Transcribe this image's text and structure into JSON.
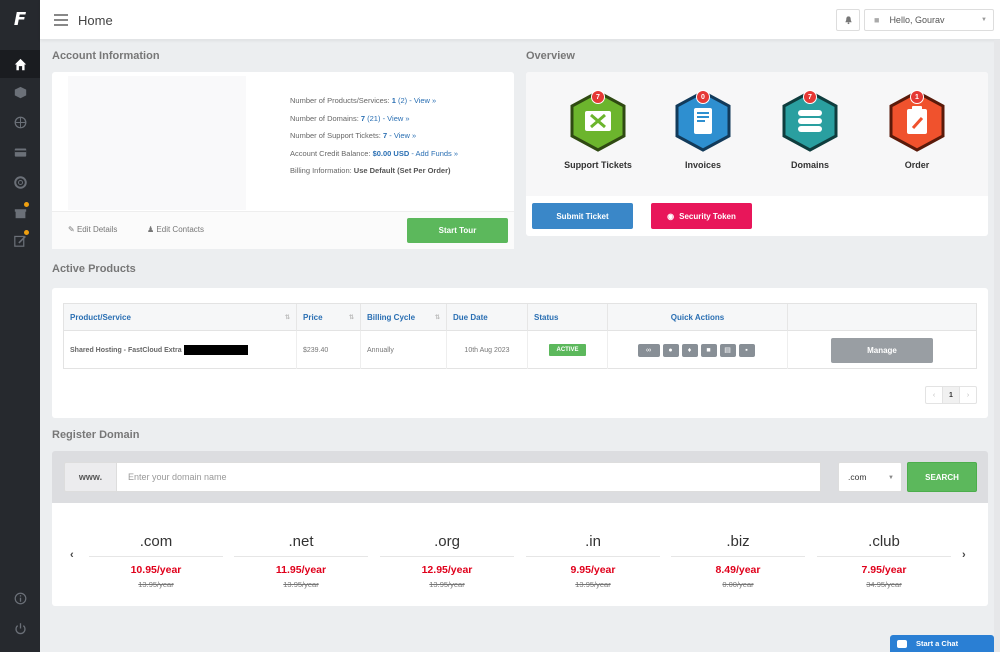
{
  "sidebar": {
    "logo": "F"
  },
  "topbar": {
    "page_title": "Home",
    "user_greeting": "Hello, Gourav"
  },
  "account": {
    "section_title": "Account Information",
    "products_label": "Number of Products/Services:",
    "products_count": "1",
    "products_total": "(2)",
    "products_link": "- View »",
    "domains_label": "Number of Domains:",
    "domains_count": "7",
    "domains_total": "(21)",
    "domains_link": "- View »",
    "tickets_label": "Number of Support Tickets:",
    "tickets_count": "7",
    "tickets_link": "- View »",
    "credit_label": "Account Credit Balance:",
    "credit_value": "$0.00 USD",
    "credit_link": "- Add Funds »",
    "billing_label": "Billing Information:",
    "billing_value": "Use Default (Set Per Order)",
    "edit_details": "Edit Details",
    "edit_contacts": "Edit Contacts",
    "start_tour": "Start Tour"
  },
  "overview": {
    "section_title": "Overview",
    "items": [
      {
        "label": "Support Tickets",
        "badge": "7",
        "color": "#6cb52d"
      },
      {
        "label": "Invoices",
        "badge": "0",
        "color": "#2e8fd0"
      },
      {
        "label": "Domains",
        "badge": "7",
        "color": "#2a9fa0"
      },
      {
        "label": "Order",
        "badge": "1",
        "color": "#f0522d"
      }
    ],
    "submit_ticket": "Submit Ticket",
    "security_token": "Security Token"
  },
  "products": {
    "section_title": "Active Products",
    "headers": {
      "product": "Product/Service",
      "price": "Price",
      "billing": "Billing Cycle",
      "due": "Due Date",
      "status": "Status",
      "actions": "Quick Actions"
    },
    "row": {
      "product": "Shared Hosting - FastCloud Extra",
      "price": "$239.40",
      "billing": "Annually",
      "due": "10th Aug 2023",
      "status": "ACTIVE",
      "manage": "Manage"
    },
    "page": "1"
  },
  "domain": {
    "section_title": "Register Domain",
    "prefix": "www.",
    "placeholder": "Enter your domain name",
    "selected_tld": ".com",
    "search": "SEARCH",
    "tlds": [
      {
        "name": ".com",
        "price": "10.95/year",
        "old": "13.95/year"
      },
      {
        "name": ".net",
        "price": "11.95/year",
        "old": "13.95/year"
      },
      {
        "name": ".org",
        "price": "12.95/year",
        "old": "13.95/year"
      },
      {
        "name": ".in",
        "price": "9.95/year",
        "old": "13.95/year"
      },
      {
        "name": ".biz",
        "price": "8.49/year",
        "old": "0.00/year"
      },
      {
        "name": ".club",
        "price": "7.95/year",
        "old": "34.95/year"
      }
    ]
  },
  "chat": {
    "label": "Start a Chat"
  },
  "colors": {
    "green": "#5cb85c",
    "blue": "#3a87c8",
    "pink": "#e8165a",
    "red_price": "#e0001b",
    "sidebar": "#26292e"
  }
}
